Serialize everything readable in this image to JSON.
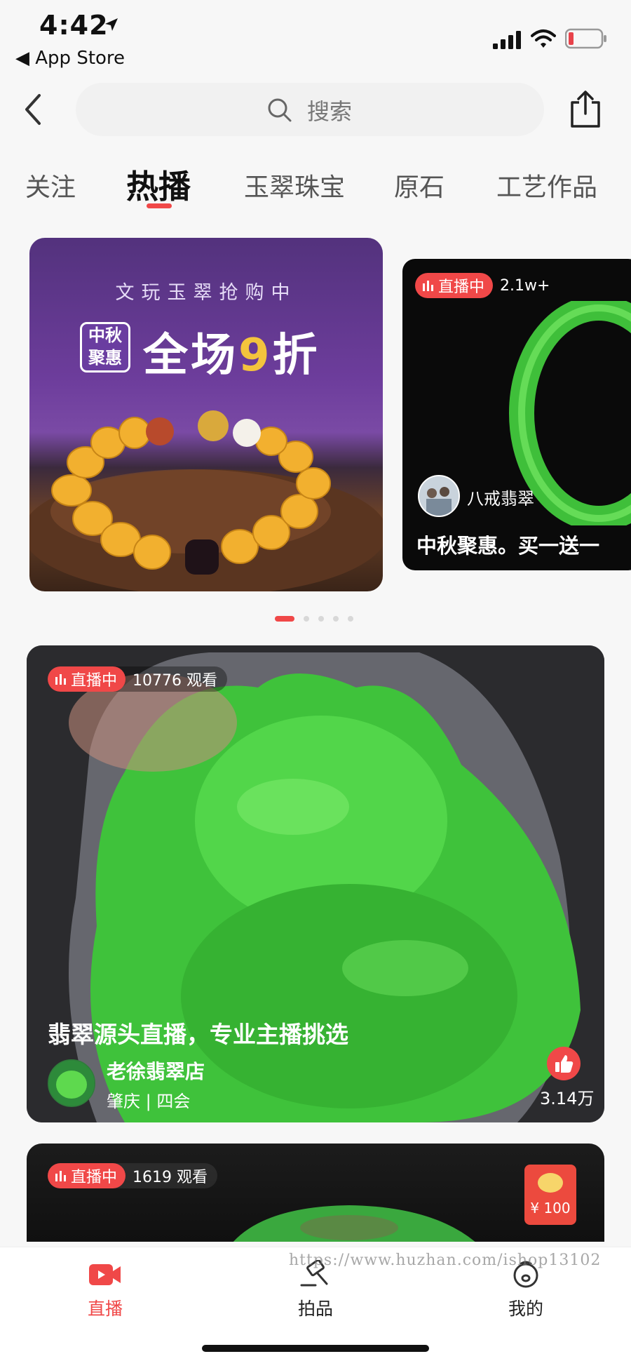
{
  "status_bar": {
    "time": "4:42",
    "back_app_label": "◀ App Store",
    "icons": [
      "location-arrow-icon",
      "signal-icon",
      "wifi-icon",
      "battery-icon"
    ]
  },
  "header": {
    "search_placeholder": "搜索",
    "icons": [
      "back-chevron-icon",
      "search-icon",
      "share-icon"
    ]
  },
  "tabs": [
    {
      "label": "关注",
      "active": false
    },
    {
      "label": "热播",
      "active": true
    },
    {
      "label": "玉翠珠宝",
      "active": false
    },
    {
      "label": "原石",
      "active": false
    },
    {
      "label": "工艺作品",
      "active": false
    }
  ],
  "banner": {
    "subtitle": "文玩玉翠抢购中",
    "tag": "中秋聚惠",
    "headline_prefix": "全场",
    "headline_number": "9",
    "headline_suffix": "折"
  },
  "side_card": {
    "live_label": "直播中",
    "viewers": "2.1w+",
    "author": "八戒翡翠",
    "title": "中秋聚惠。买一送一"
  },
  "carousel": {
    "dots": 5,
    "active_index": 0
  },
  "live_cards": [
    {
      "live_label": "直播中",
      "viewers": "10776 观看",
      "title": "翡翠源头直播，专业主播挑选",
      "shop": "老徐翡翠店",
      "location": "肇庆 | 四会",
      "likes": "3.14万"
    },
    {
      "live_label": "直播中",
      "viewers": "1619 观看",
      "red_packet": "¥ 100"
    }
  ],
  "bottom_nav": [
    {
      "label": "直播",
      "icon": "live-video-icon",
      "active": true
    },
    {
      "label": "拍品",
      "icon": "auction-hammer-icon",
      "active": false
    },
    {
      "label": "我的",
      "icon": "profile-face-icon",
      "active": false
    }
  ],
  "watermark": "https://www.huzhan.com/ishop13102",
  "colors": {
    "accent": "#f04848",
    "background": "#f7f7f7"
  }
}
